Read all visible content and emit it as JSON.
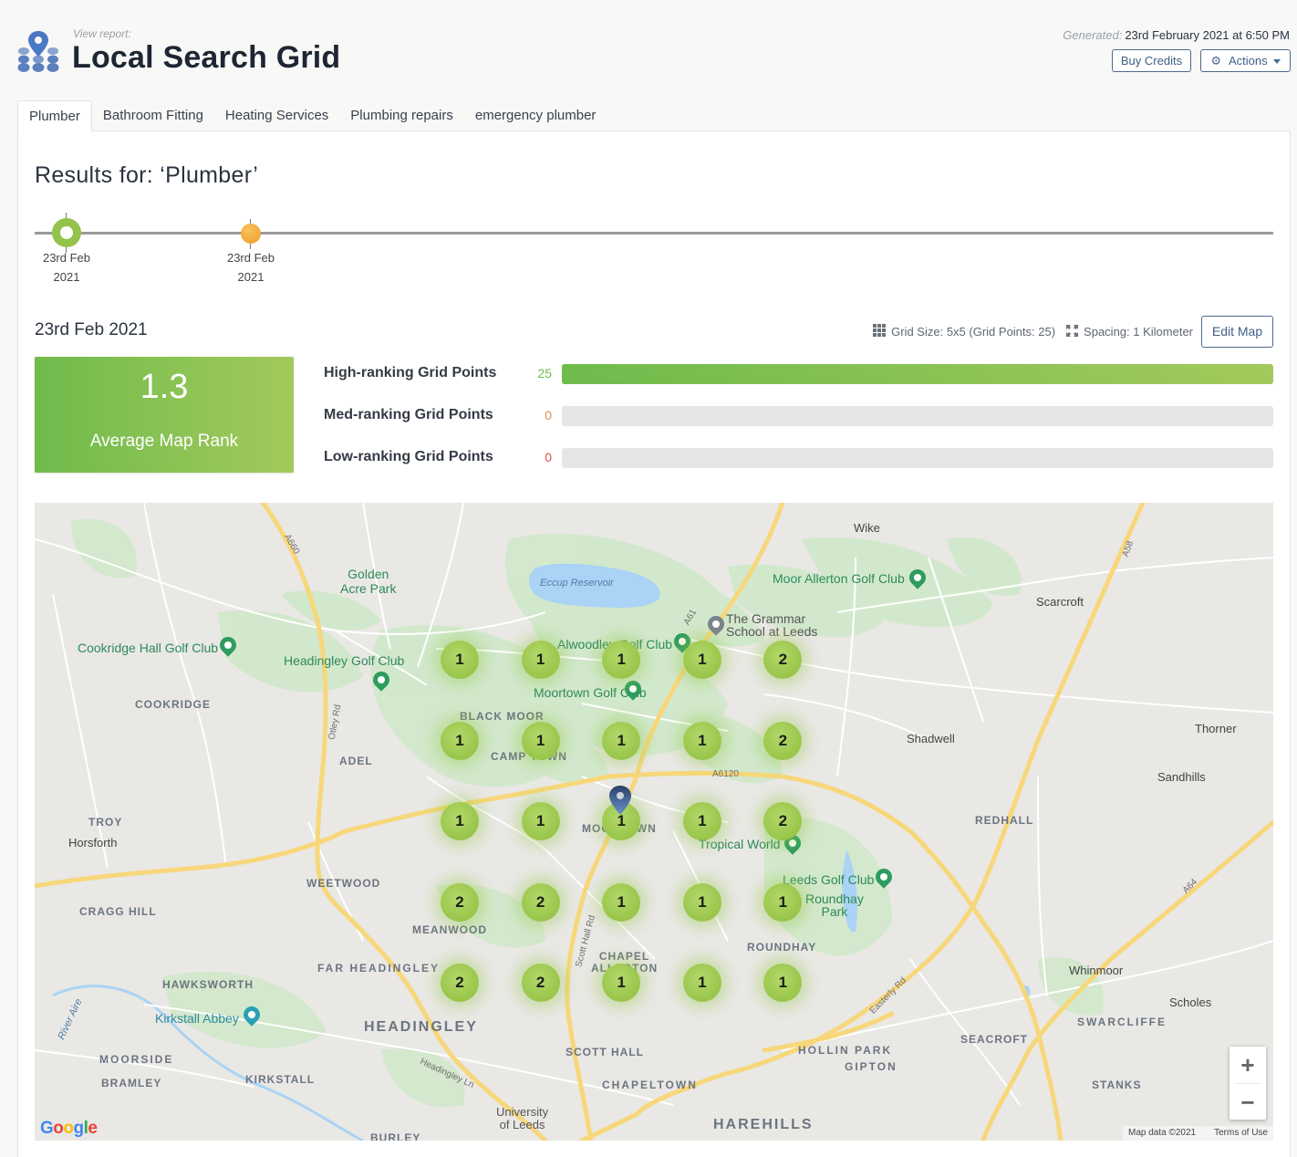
{
  "header": {
    "view_report_label": "View report:",
    "title": "Local Search Grid",
    "generated_label": "Generated:",
    "generated_value": "23rd February 2021 at 6:50 PM",
    "buy_credits_label": "Buy Credits",
    "actions_label": "Actions",
    "logo_icon": "map-pin-grid-icon"
  },
  "tabs": [
    {
      "label": "Plumber",
      "active": true
    },
    {
      "label": "Bathroom Fitting",
      "active": false
    },
    {
      "label": "Heating Services",
      "active": false
    },
    {
      "label": "Plumbing repairs",
      "active": false
    },
    {
      "label": "emergency plumber",
      "active": false
    }
  ],
  "results_title": "Results for: ‘Plumber’",
  "timeline": {
    "nodes": [
      {
        "date_line1": "23rd Feb",
        "date_line2": "2021",
        "state": "selected",
        "color": "#93c34a"
      },
      {
        "date_line1": "23rd Feb",
        "date_line2": "2021",
        "state": "other",
        "color": "#ef9a2c"
      }
    ]
  },
  "snapshot": {
    "date": "23rd Feb 2021",
    "grid_size_label": "Grid Size: 5x5 (Grid Points: 25)",
    "spacing_label": "Spacing: 1 Kilometer",
    "edit_map_label": "Edit Map"
  },
  "average": {
    "value": "1.3",
    "label": "Average Map Rank"
  },
  "rankings": [
    {
      "label": "High-ranking Grid Points",
      "count": "25",
      "fraction": 1.0,
      "color": "#6fbb4c"
    },
    {
      "label": "Med-ranking Grid Points",
      "count": "0",
      "fraction": 0.0,
      "color": "#e08a4c"
    },
    {
      "label": "Low-ranking Grid Points",
      "count": "0",
      "fraction": 0.0,
      "color": "#d9534f"
    }
  ],
  "map": {
    "grid_ranks": [
      [
        1,
        1,
        1,
        1,
        2
      ],
      [
        1,
        1,
        1,
        1,
        2
      ],
      [
        1,
        1,
        1,
        1,
        2
      ],
      [
        2,
        2,
        1,
        1,
        1
      ],
      [
        2,
        2,
        1,
        1,
        1
      ]
    ],
    "labels": {
      "golden_acre": "Golden\nAcre Park",
      "eccup": "Eccup Reservoir",
      "wike": "Wike",
      "moor_allerton": "Moor Allerton Golf Club",
      "scarcroft": "Scarcroft",
      "grammar": "The Grammar\nSchool at Leeds",
      "alwoodley": "Alwoodley Golf Club",
      "cookridge_hall": "Cookridge Hall Golf Club",
      "headingley_golf": "Headingley Golf Club",
      "moortown_golf": "Moortown Golf Club",
      "cookridge": "COOKRIDGE",
      "black_moor": "BLACK MOOR",
      "camp_town": "CAMP TOWN",
      "adel": "ADEL",
      "shadwell": "Shadwell",
      "thorner": "Thorner",
      "sandhills": "Sandhills",
      "troy": "TROY",
      "horsforth": "Horsforth",
      "moortown": "MOORTOWN",
      "tropical_world": "Tropical World",
      "redhall": "REDHALL",
      "weetwood": "WEETWOOD",
      "cragg_hill": "CRAGG HILL",
      "leeds_golf": "Leeds Golf Club",
      "roundhay_park": "Roundhay\nPark",
      "meanwood": "MEANWOOD",
      "roundhay": "ROUNDHAY",
      "chapel_allerton": "CHAPEL\nALLERTON",
      "far_headingley": "FAR HEADINGLEY",
      "hawksworth": "HAWKSWORTH",
      "whinmoor": "Whinmoor",
      "scholes": "Scholes",
      "kirkstall_abbey": "Kirkstall Abbey",
      "headingley": "HEADINGLEY",
      "swarcliffe": "SWARCLIFFE",
      "moorside": "MOORSIDE",
      "seacroft": "SEACROFT",
      "scott_hall": "SCOTT HALL",
      "hollin_park": "HOLLIN PARK",
      "gipton": "GIPTON",
      "bramley": "BRAMLEY",
      "kirkstall": "KIRKSTALL",
      "chapeltown": "CHAPELTOWN",
      "stanks": "STANKS",
      "university": "University\nof Leeds",
      "harehills": "HAREHILLS",
      "burley": "BURLEY",
      "a660": "A660",
      "a61": "A61",
      "a6120": "A6120",
      "a58": "A58",
      "a64": "A64",
      "otley_rd": "Otley Rd",
      "scott_hall_rd": "Scott Hall Rd",
      "easterly_rd": "Easterly Rd",
      "headingley_ln": "Headingley Ln",
      "river_aire": "River Aire"
    },
    "zoom_in_label": "+",
    "zoom_out_label": "−",
    "attribution": "Map data ©2021",
    "terms": "Terms of Use",
    "google_logo": "Google"
  }
}
